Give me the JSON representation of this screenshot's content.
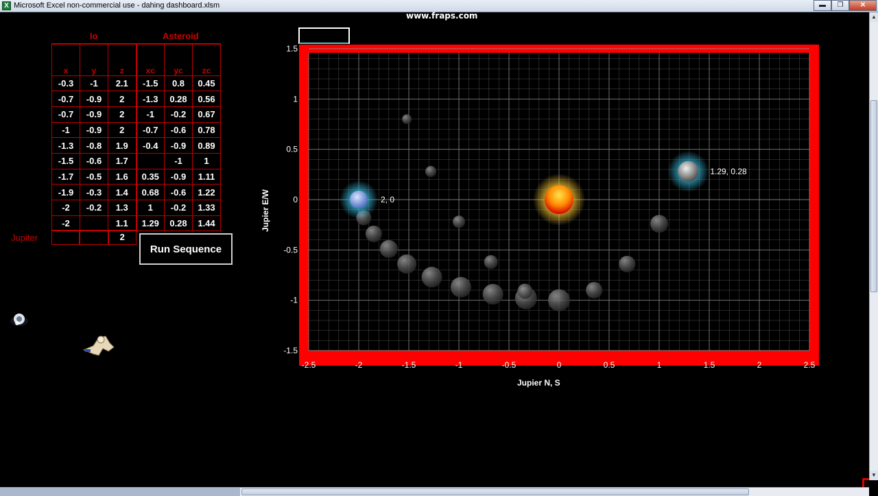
{
  "window": {
    "title": "Microsoft Excel non-commercial use - dahing dashboard.xlsm",
    "app_icon": "excel-icon",
    "minimize_glyph": "▬",
    "restore_glyph": "❐",
    "close_glyph": "✕"
  },
  "watermark": "www.fraps.com",
  "table": {
    "group_io": "Io",
    "group_asteroid": "Asteroid",
    "headers": [
      "x",
      "y",
      "z",
      "xc",
      "yc",
      "zc"
    ],
    "rows": [
      [
        "-0.3",
        "-1",
        "2.1",
        "-1.5",
        "0.8",
        "0.45"
      ],
      [
        "-0.7",
        "-0.9",
        "2",
        "-1.3",
        "0.28",
        "0.56"
      ],
      [
        "-0.7",
        "-0.9",
        "2",
        "-1",
        "-0.2",
        "0.67"
      ],
      [
        "-1",
        "-0.9",
        "2",
        "-0.7",
        "-0.6",
        "0.78"
      ],
      [
        "-1.3",
        "-0.8",
        "1.9",
        "-0.4",
        "-0.9",
        "0.89"
      ],
      [
        "-1.5",
        "-0.6",
        "1.7",
        "",
        "-1",
        "1"
      ],
      [
        "-1.7",
        "-0.5",
        "1.6",
        "0.35",
        "-0.9",
        "1.11"
      ],
      [
        "-1.9",
        "-0.3",
        "1.4",
        "0.68",
        "-0.6",
        "1.22"
      ],
      [
        "-2",
        "-0.2",
        "1.3",
        "1",
        "-0.2",
        "1.33"
      ],
      [
        "-2",
        "",
        "1.1",
        "1.29",
        "0.28",
        "1.44"
      ]
    ],
    "jupiter_label": "Jupiter",
    "jupiter_row": [
      "",
      "",
      "2"
    ]
  },
  "run_button": "Run Sequence",
  "chart_data": {
    "type": "scatter",
    "title": "",
    "xlabel": "Jupier  N, S",
    "ylabel": "Jupier  E/W",
    "xlim": [
      -2.5,
      2.5
    ],
    "ylim": [
      -1.5,
      1.5
    ],
    "xticks": [
      "-2.5",
      "-2",
      "-1.5",
      "-1",
      "-0.5",
      "0",
      "0.5",
      "1",
      "1.5",
      "2",
      "2.5"
    ],
    "yticks": [
      "1.5",
      "1",
      "0.5",
      "0",
      "-0.5",
      "-1",
      "-1.5"
    ],
    "grid": true,
    "colors": {
      "frame": "#ff0000",
      "grid": "#8a8a8a",
      "sun": "#ff8800",
      "glow": "#33aacc"
    },
    "series": [
      {
        "points": [
          {
            "x": -1.95,
            "y": -0.18,
            "r": 11
          },
          {
            "x": -1.85,
            "y": -0.34,
            "r": 12
          },
          {
            "x": -1.7,
            "y": -0.49,
            "r": 13
          },
          {
            "x": -1.52,
            "y": -0.64,
            "r": 14
          },
          {
            "x": -1.27,
            "y": -0.77,
            "r": 15
          },
          {
            "x": -0.98,
            "y": -0.87,
            "r": 15
          },
          {
            "x": -0.66,
            "y": -0.94,
            "r": 15
          },
          {
            "x": -0.33,
            "y": -0.98,
            "r": 16
          },
          {
            "x": 0.0,
            "y": -1.0,
            "r": 16
          },
          {
            "x": 0.35,
            "y": -0.9,
            "r": 12
          },
          {
            "x": 0.68,
            "y": -0.64,
            "r": 12
          },
          {
            "x": 1.0,
            "y": -0.24,
            "r": 13
          },
          {
            "x": -1.52,
            "y": 0.8,
            "r": 7
          },
          {
            "x": -1.28,
            "y": 0.28,
            "r": 8
          },
          {
            "x": -1.0,
            "y": -0.22,
            "r": 9
          },
          {
            "x": -0.68,
            "y": -0.62,
            "r": 10
          },
          {
            "x": -0.34,
            "y": -0.91,
            "r": 11
          }
        ]
      }
    ],
    "markers": [
      {
        "x": -2,
        "y": 0,
        "label": "2, 0",
        "kind": "io-moon"
      },
      {
        "x": 1.29,
        "y": 0.28,
        "label": "1.29, 0.28",
        "kind": "asteroid"
      },
      {
        "x": 0,
        "y": 0,
        "label": "",
        "kind": "jupiter-sun"
      }
    ]
  }
}
